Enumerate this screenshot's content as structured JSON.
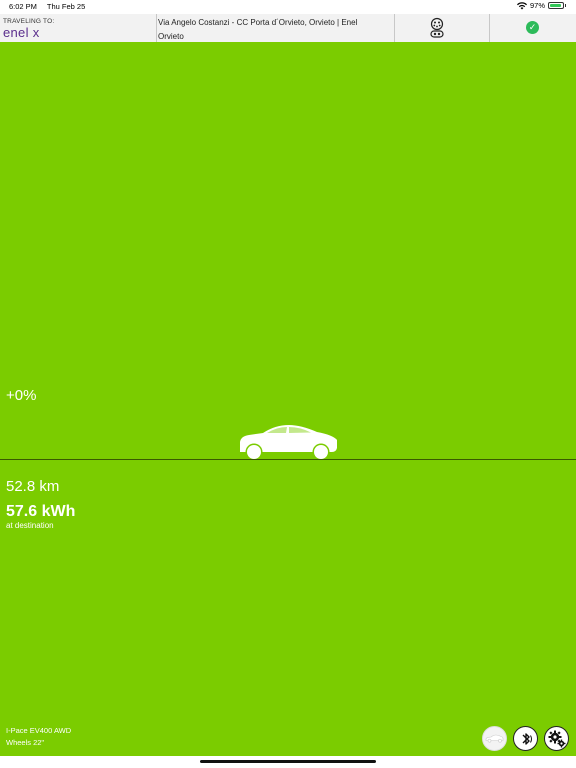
{
  "status_bar": {
    "time": "6:02 PM",
    "date": "Thu Feb 25",
    "battery": "97%",
    "icons": [
      "wifi-icon",
      "battery-icon"
    ]
  },
  "header": {
    "travel_label": "TRAVELING TO:",
    "brand": "enel x",
    "destination_line1": "Via Angelo Costanzi - CC Porta d´Orvieto, Orvieto | Enel",
    "destination_line2": "Orvieto",
    "icons": [
      "connector-icon",
      "check-icon"
    ]
  },
  "main": {
    "background_color": "#7bcc00",
    "soc_change": "+0%",
    "distance": "52.8 km",
    "energy": "57.6 kWh",
    "energy_label": "at destination",
    "vehicle_name": "I-Pace EV400 AWD",
    "vehicle_wheels": "Wheels 22\"",
    "icons": [
      "car-icon",
      "vehicle-icon",
      "bluetooth-icon",
      "settings-icon"
    ]
  }
}
